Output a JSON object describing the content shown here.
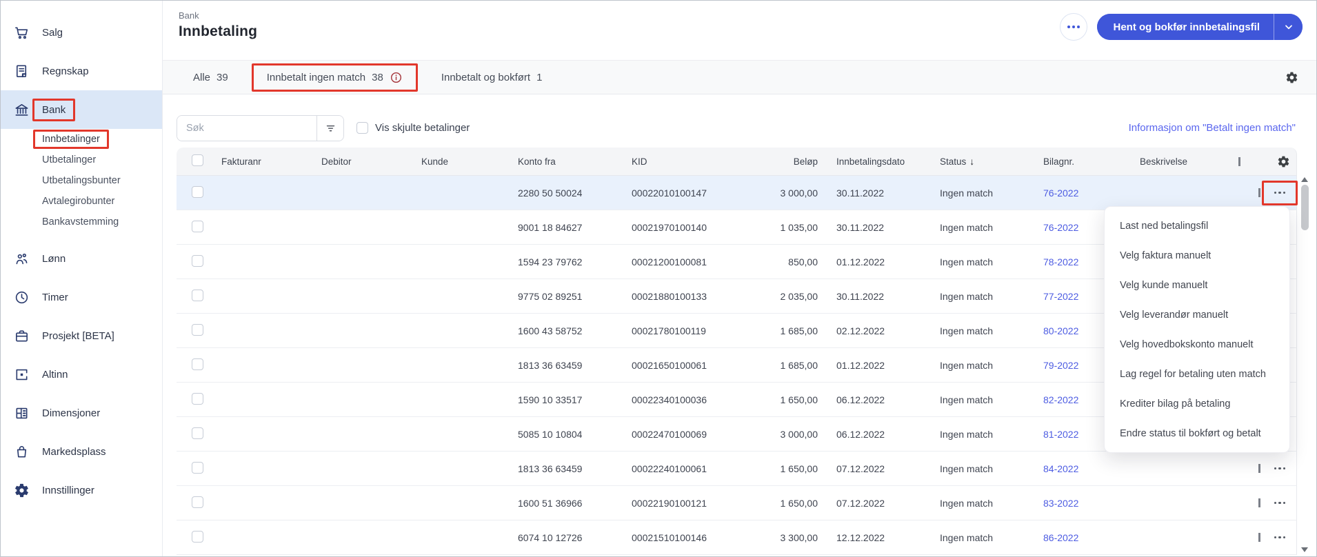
{
  "header": {
    "breadcrumb": "Bank",
    "title": "Innbetaling",
    "primary_button": {
      "label": "Hent og bokfør innbetalingsfil",
      "has_dropdown": true
    },
    "more_button_icon": "ellipsis-icon"
  },
  "tabs": [
    {
      "label": "Alle",
      "count": "39"
    },
    {
      "label": "Innbetalt ingen match",
      "count": "38",
      "has_info_icon": true,
      "annotated": true
    },
    {
      "label": "Innbetalt og bokført",
      "count": "1"
    }
  ],
  "toolbar": {
    "search_placeholder": "Søk",
    "search_value": "",
    "show_hidden_label": "Vis skjulte betalinger",
    "show_hidden_checked": false,
    "info_link": "Informasjon om \"Betalt ingen match\""
  },
  "table": {
    "columns": [
      "Fakturanr",
      "Debitor",
      "Kunde",
      "Konto fra",
      "KID",
      "Beløp",
      "Innbetalingsdato",
      "Status",
      "Bilagnr.",
      "Beskrivelse"
    ],
    "sort": {
      "column": "Status",
      "direction": "desc"
    },
    "rows": [
      {
        "fakturanr": "",
        "debitor": "",
        "kunde": "",
        "konto_fra": "2280 50 50024",
        "kid": "00022010100147",
        "belop": "3 000,00",
        "dato": "30.11.2022",
        "status": "Ingen match",
        "bilagnr": "76-2022",
        "beskrivelse": "",
        "selected": true,
        "annotated": true
      },
      {
        "fakturanr": "",
        "debitor": "",
        "kunde": "",
        "konto_fra": "9001 18 84627",
        "kid": "00021970100140",
        "belop": "1 035,00",
        "dato": "30.11.2022",
        "status": "Ingen match",
        "bilagnr": "76-2022",
        "beskrivelse": ""
      },
      {
        "fakturanr": "",
        "debitor": "",
        "kunde": "",
        "konto_fra": "1594 23 79762",
        "kid": "00021200100081",
        "belop": "850,00",
        "dato": "01.12.2022",
        "status": "Ingen match",
        "bilagnr": "78-2022",
        "beskrivelse": ""
      },
      {
        "fakturanr": "",
        "debitor": "",
        "kunde": "",
        "konto_fra": "9775 02 89251",
        "kid": "00021880100133",
        "belop": "2 035,00",
        "dato": "30.11.2022",
        "status": "Ingen match",
        "bilagnr": "77-2022",
        "beskrivelse": ""
      },
      {
        "fakturanr": "",
        "debitor": "",
        "kunde": "",
        "konto_fra": "1600 43 58752",
        "kid": "00021780100119",
        "belop": "1 685,00",
        "dato": "02.12.2022",
        "status": "Ingen match",
        "bilagnr": "80-2022",
        "beskrivelse": ""
      },
      {
        "fakturanr": "",
        "debitor": "",
        "kunde": "",
        "konto_fra": "1813 36 63459",
        "kid": "00021650100061",
        "belop": "1 685,00",
        "dato": "01.12.2022",
        "status": "Ingen match",
        "bilagnr": "79-2022",
        "beskrivelse": ""
      },
      {
        "fakturanr": "",
        "debitor": "",
        "kunde": "",
        "konto_fra": "1590 10 33517",
        "kid": "00022340100036",
        "belop": "1 650,00",
        "dato": "06.12.2022",
        "status": "Ingen match",
        "bilagnr": "82-2022",
        "beskrivelse": ""
      },
      {
        "fakturanr": "",
        "debitor": "",
        "kunde": "",
        "konto_fra": "5085 10 10804",
        "kid": "00022470100069",
        "belop": "3 000,00",
        "dato": "06.12.2022",
        "status": "Ingen match",
        "bilagnr": "81-2022",
        "beskrivelse": ""
      },
      {
        "fakturanr": "",
        "debitor": "",
        "kunde": "",
        "konto_fra": "1813 36 63459",
        "kid": "00022240100061",
        "belop": "1 650,00",
        "dato": "07.12.2022",
        "status": "Ingen match",
        "bilagnr": "84-2022",
        "beskrivelse": ""
      },
      {
        "fakturanr": "",
        "debitor": "",
        "kunde": "",
        "konto_fra": "1600 51 36966",
        "kid": "00022190100121",
        "belop": "1 650,00",
        "dato": "07.12.2022",
        "status": "Ingen match",
        "bilagnr": "83-2022",
        "beskrivelse": ""
      },
      {
        "fakturanr": "",
        "debitor": "",
        "kunde": "",
        "konto_fra": "6074 10 12726",
        "kid": "00021510100146",
        "belop": "3 300,00",
        "dato": "12.12.2022",
        "status": "Ingen match",
        "bilagnr": "86-2022",
        "beskrivelse": ""
      }
    ]
  },
  "context_menu": {
    "items": [
      "Last ned betalingsfil",
      "Velg faktura manuelt",
      "Velg kunde manuelt",
      "Velg leverandør manuelt",
      "Velg hovedbokskonto manuelt",
      "Lag regel for betaling uten match",
      "Krediter bilag på betaling",
      "Endre status til bokført og betalt"
    ]
  },
  "sidebar": {
    "items": [
      {
        "label": "Salg",
        "icon": "cart-icon"
      },
      {
        "label": "Regnskap",
        "icon": "ledger-icon"
      },
      {
        "label": "Bank",
        "icon": "bank-icon",
        "active": true,
        "annotated": true,
        "sub": [
          {
            "label": "Innbetalinger",
            "annotated": true,
            "active": true
          },
          {
            "label": "Utbetalinger"
          },
          {
            "label": "Utbetalingsbunter"
          },
          {
            "label": "Avtalegirobunter"
          },
          {
            "label": "Bankavstemming"
          }
        ]
      },
      {
        "label": "Lønn",
        "icon": "people-icon"
      },
      {
        "label": "Timer",
        "icon": "clock-icon"
      },
      {
        "label": "Prosjekt [BETA]",
        "icon": "briefcase-icon"
      },
      {
        "label": "Altinn",
        "icon": "altinn-icon"
      },
      {
        "label": "Dimensjoner",
        "icon": "grid-icon"
      },
      {
        "label": "Markedsplass",
        "icon": "bag-icon"
      },
      {
        "label": "Innstillinger",
        "icon": "gear-icon"
      }
    ]
  },
  "annotations": [
    "sidebar-bank",
    "sidebar-innbetalinger",
    "tab-innbetalt-ingen-match",
    "row-1-actions-button"
  ],
  "colors": {
    "primary_button": "#3f56d9",
    "annotation_red": "#e2372b",
    "link": "#5a66ee",
    "bilagnr_link": "#4d5ce2",
    "selected_row": "#e9f1fc",
    "sidebar_active": "#dbe7f7"
  }
}
